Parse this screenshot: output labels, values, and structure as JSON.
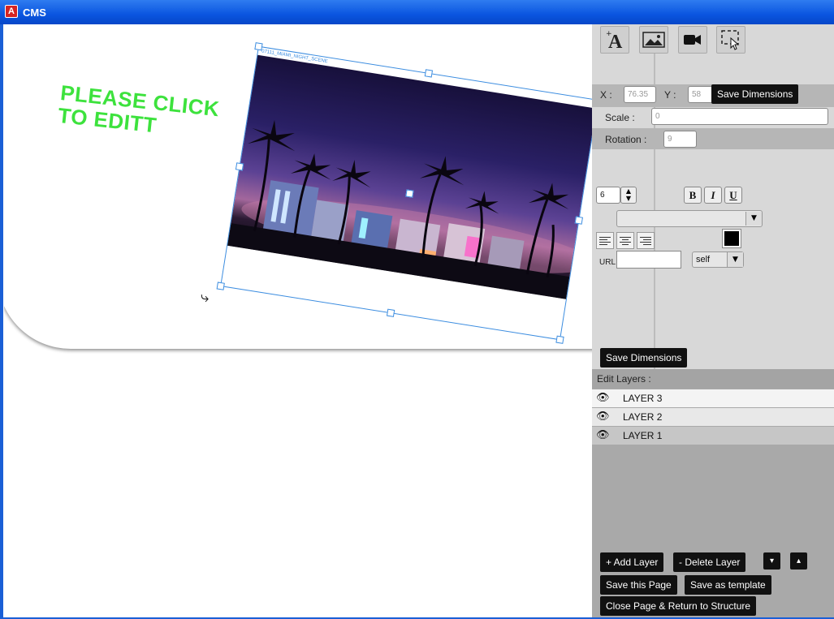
{
  "window": {
    "title": "CMS",
    "app_icon_glyph": "A"
  },
  "canvas": {
    "headline": "PLEASE CLICK TO EDITT",
    "image_caption": "07111_MIAMI_NIGHT_SCENE",
    "rotate_icon": "rotate-arrow-icon"
  },
  "toolbar": {
    "tools": [
      "add-text-icon",
      "add-image-icon",
      "add-video-icon",
      "select-area-icon"
    ]
  },
  "dimensions": {
    "x_label": "X :",
    "x_value": "76.35",
    "y_label": "Y :",
    "y_value": "58",
    "save_dimensions_label": "Save Dimensions",
    "scale_label": "Scale :",
    "scale_value": "0",
    "rotation_label": "Rotation :",
    "rotation_value": "9"
  },
  "text_format": {
    "font_size": "6",
    "bold": "B",
    "italic": "I",
    "underline": "U",
    "font_family_value": "",
    "url_label": "URL",
    "url_value": "",
    "target_value": "self",
    "color": "#000000"
  },
  "save_dimensions_button": "Save Dimensions",
  "layers": {
    "header": "Edit Layers :",
    "items": [
      {
        "label": "LAYER 3"
      },
      {
        "label": "LAYER 2"
      },
      {
        "label": "LAYER 1"
      }
    ],
    "add_label": "+ Add Layer",
    "delete_label": "- Delete Layer",
    "down_label": "▾",
    "up_label": "▴"
  },
  "actions": {
    "save_page": "Save this Page",
    "save_template": "Save as template",
    "close_page": "Close Page & Return to Structure"
  },
  "colors": {
    "accent_green": "#3de23d",
    "selection_blue": "#3c8de0",
    "titlebar": "#0a55e0"
  }
}
